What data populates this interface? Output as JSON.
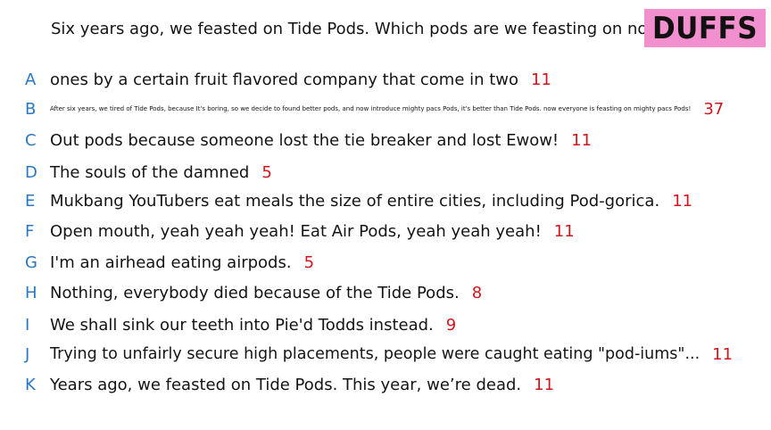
{
  "question": "Six years ago, we feasted on Tide Pods. Which pods are we feasting on now?",
  "badge": {
    "label": "DUFFS",
    "color": "#f28fce"
  },
  "colors": {
    "letter": "#2b78c2",
    "score": "#d1161c",
    "text": "#141414"
  },
  "answers": [
    {
      "letter": "A",
      "text": "ones by a certain fruit flavored company that come in two",
      "score": "11"
    },
    {
      "letter": "B",
      "text": "After six years, we tired of Tide Pods, because It's boring, so we decide to found better pods, and now introduce mighty pacs Pods, it's better than Tide Pods. now everyone is feasting on mighty pacs Pods!",
      "score": "37"
    },
    {
      "letter": "C",
      "text": "Out pods because someone lost the tie breaker and lost Ewow!",
      "score": "11"
    },
    {
      "letter": "D",
      "text": "The souls of the damned",
      "score": "5"
    },
    {
      "letter": "E",
      "text": "Mukbang YouTubers eat meals the size of entire cities, including Pod-gorica.",
      "score": "11"
    },
    {
      "letter": "F",
      "text": "Open mouth, yeah yeah yeah! Eat Air Pods, yeah yeah yeah!",
      "score": "11"
    },
    {
      "letter": "G",
      "text": "I'm an airhead eating airpods.",
      "score": "5"
    },
    {
      "letter": "H",
      "text": "Nothing, everybody died because of the Tide Pods.",
      "score": "8"
    },
    {
      "letter": "I",
      "text": "We shall sink our teeth into Pie'd Todds instead.",
      "score": "9"
    },
    {
      "letter": "J",
      "text": "Trying to unfairly secure high placements, people were caught eating \"pod-iums\"...",
      "score": "11"
    },
    {
      "letter": "K",
      "text": "Years ago, we feasted on Tide Pods. This year, we’re dead.",
      "score": "11"
    }
  ]
}
